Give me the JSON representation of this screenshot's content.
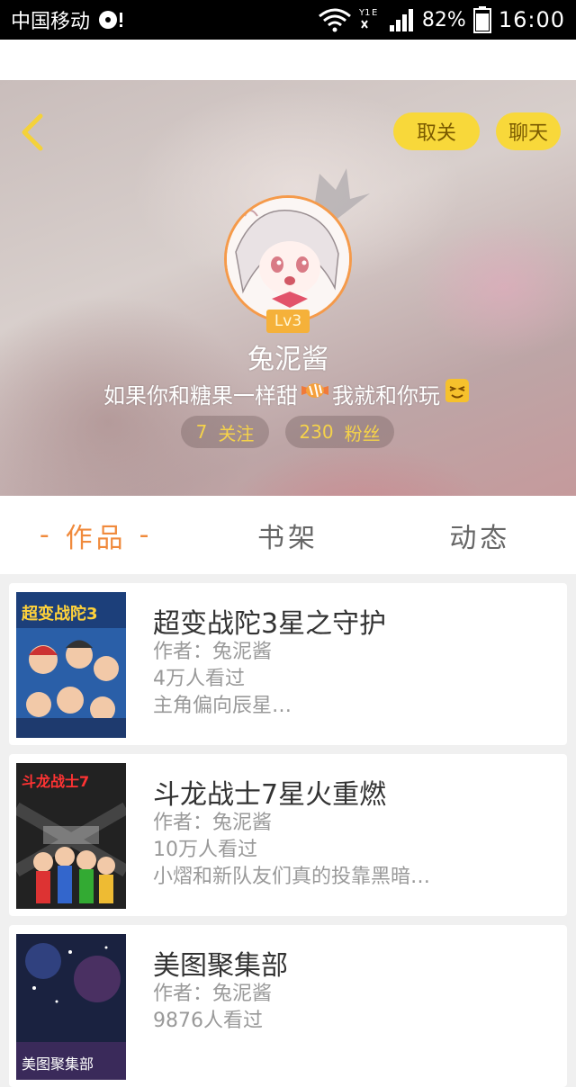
{
  "status_bar": {
    "carrier": "中国移动",
    "battery": "82%",
    "time": "16:00",
    "signal_labels": [
      "Y1",
      "E"
    ]
  },
  "profile": {
    "unfollow_label": "取关",
    "chat_label": "聊天",
    "level": "Lv3",
    "nickname": "兔泥酱",
    "bio_part1": "如果你和糖果一样甜",
    "bio_part2": "我就和你玩",
    "following_count": "7",
    "following_label": "关注",
    "fans_count": "230",
    "fans_label": "粉丝"
  },
  "tabs": [
    {
      "label": "作品",
      "active": true
    },
    {
      "label": "书架",
      "active": false
    },
    {
      "label": "动态",
      "active": false
    }
  ],
  "works": [
    {
      "title": "超变战陀3星之守护",
      "author": "作者：兔泥酱",
      "views": "4万人看过",
      "desc": "主角偏向辰星…",
      "cover_text": "超变战陀3"
    },
    {
      "title": "斗龙战士7星火重燃",
      "author": "作者：兔泥酱",
      "views": "10万人看过",
      "desc": "小熠和新队友们真的投靠黑暗…",
      "cover_text": "斗龙战士7"
    },
    {
      "title": "美图聚集部",
      "author": "作者：兔泥酱",
      "views": "9876人看过",
      "desc": "",
      "cover_text": "美图聚集部"
    }
  ],
  "colors": {
    "accent_orange": "#f08a3c",
    "button_yellow": "#f8d83a",
    "stat_yellow": "#f5d24a"
  }
}
